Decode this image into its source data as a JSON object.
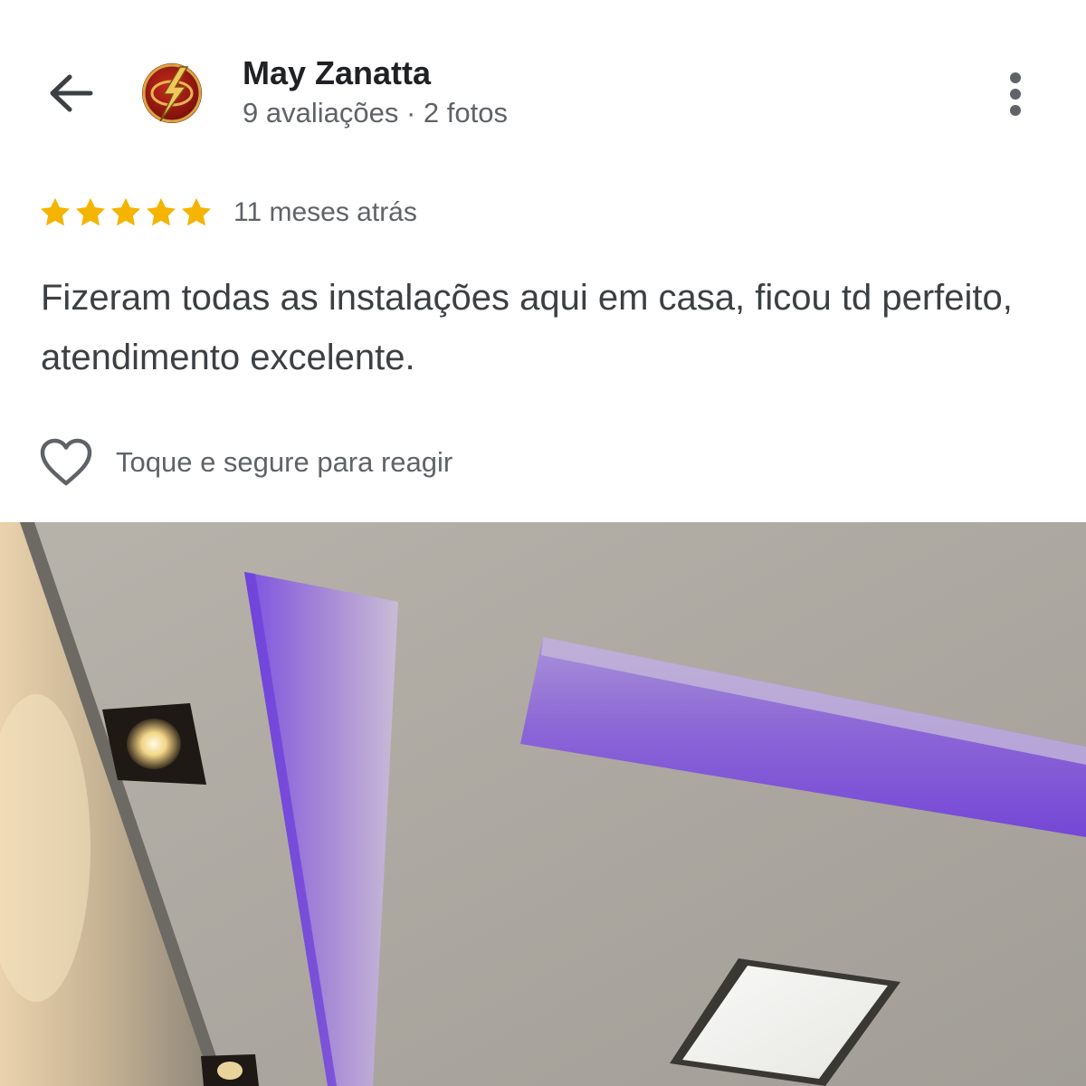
{
  "header": {
    "back_icon": "arrow-back-icon",
    "avatar_icon": "flash-emblem-avatar",
    "name": "May Zanatta",
    "meta": "9 avaliações · 2 fotos",
    "more_icon": "more-vert-icon"
  },
  "review": {
    "stars": 5,
    "star_color": "#f4b400",
    "time": "11 meses atrás",
    "text": "Fizeram todas as instalações aqui em casa, ficou td perfeito, atendimento excelente."
  },
  "reaction": {
    "icon": "heart-outline-icon",
    "label": "Toque e segure para reagir"
  },
  "photo": {
    "subject": "ceiling-with-purple-led-strips"
  }
}
